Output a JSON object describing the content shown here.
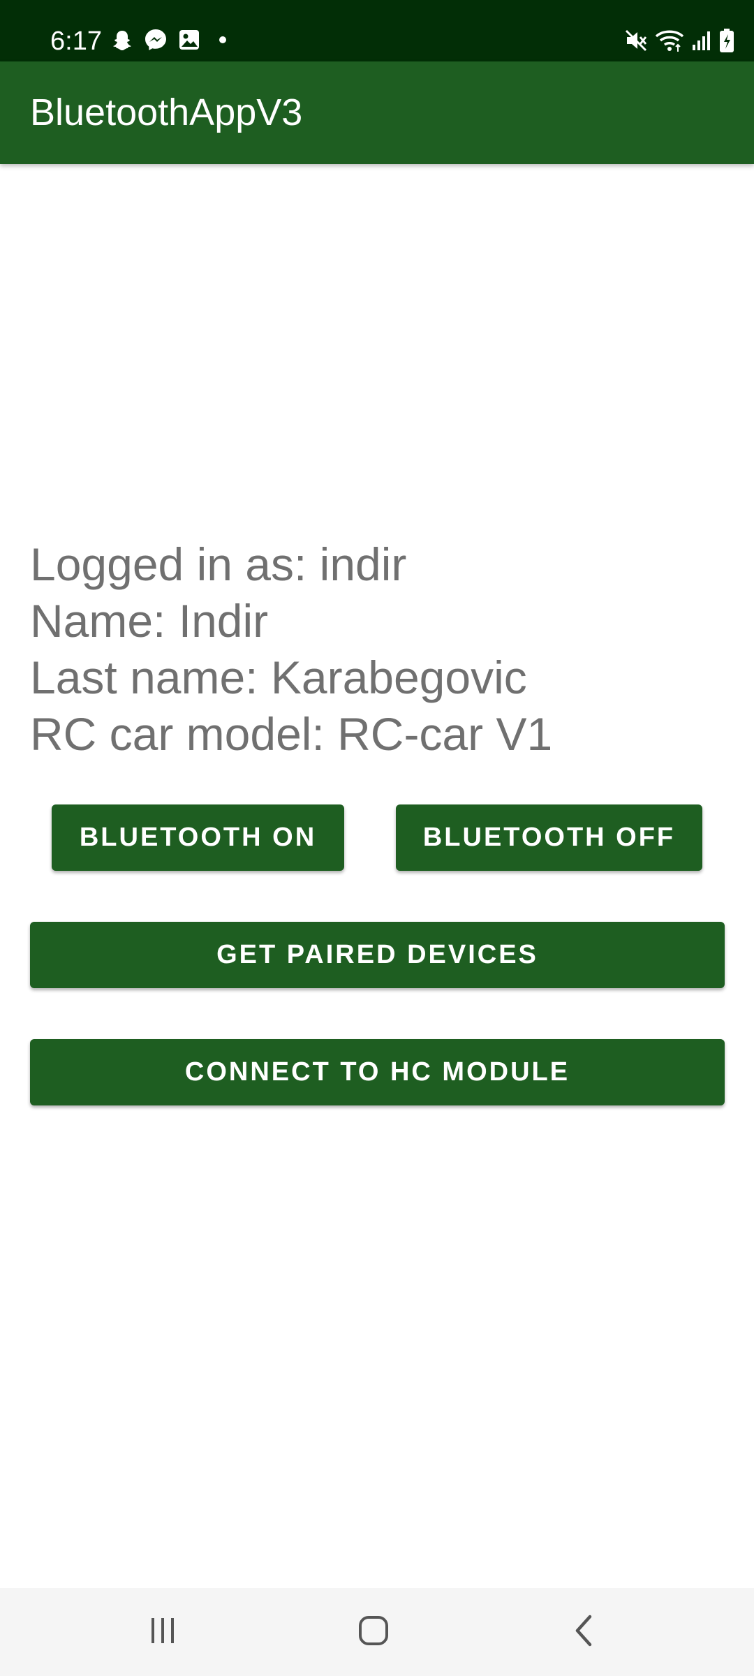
{
  "status_bar": {
    "time": "6:17",
    "notification_icons": [
      "snapchat-icon",
      "messenger-icon",
      "gallery-icon",
      "more-dot-icon"
    ],
    "system_icons": [
      "mute-icon",
      "wifi-icon",
      "signal-icon",
      "battery-charging-icon"
    ]
  },
  "app_bar": {
    "title": "BluetoothAppV3",
    "color": "#1e5e21"
  },
  "user_info": {
    "logged_in": "Logged in as: indir",
    "name": "Name: Indir",
    "last_name": "Last name: Karabegovic",
    "car_model": "RC car model: RC-car V1"
  },
  "buttons": {
    "bluetooth_on": "BLUETOOTH ON",
    "bluetooth_off": "BLUETOOTH OFF",
    "get_paired": "GET PAIRED DEVICES",
    "connect_hc": "CONNECT TO HC MODULE"
  },
  "nav_bar": {
    "icons": [
      "recents-icon",
      "home-icon",
      "back-icon"
    ]
  },
  "colors": {
    "status_bar": "#022e06",
    "primary": "#1e5e21",
    "text_secondary": "#707070"
  }
}
